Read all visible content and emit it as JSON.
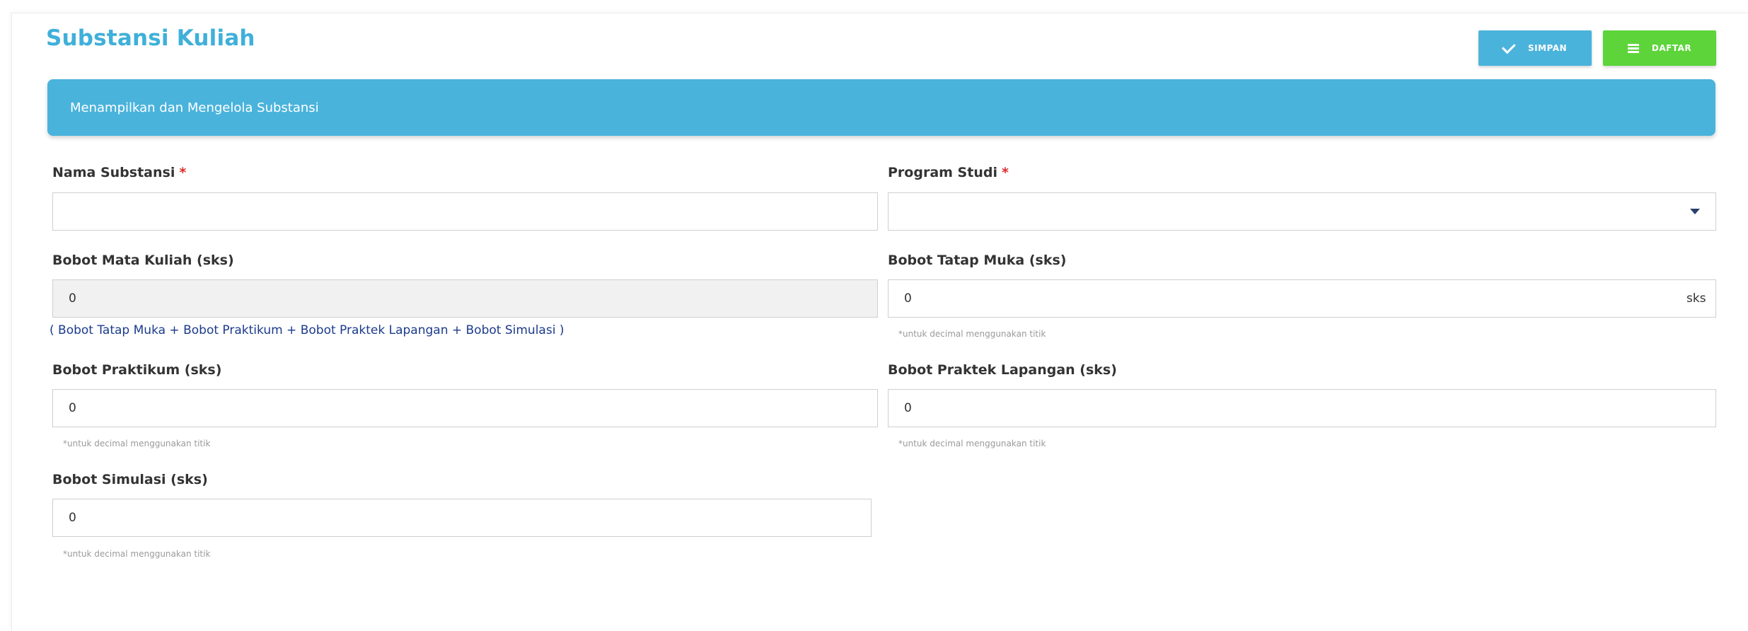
{
  "header": {
    "title": "Substansi Kuliah",
    "simpan_label": "SIMPAN",
    "daftar_label": "DAFTAR"
  },
  "banner": {
    "text": "Menampilkan dan Mengelola Substansi"
  },
  "form": {
    "nama_substansi": {
      "label": "Nama Substansi",
      "required": "*",
      "value": ""
    },
    "program_studi": {
      "label": "Program Studi",
      "required": "*",
      "selected": ""
    },
    "bobot_mata_kuliah": {
      "label": "Bobot Mata Kuliah (sks)",
      "value": "0",
      "formula": "( Bobot Tatap Muka + Bobot Praktikum + Bobot Praktek Lapangan + Bobot Simulasi )"
    },
    "bobot_tatap_muka": {
      "label": "Bobot Tatap Muka (sks)",
      "value": "0",
      "suffix": "sks",
      "hint": "*untuk decimal menggunakan titik"
    },
    "bobot_praktikum": {
      "label": "Bobot Praktikum (sks)",
      "value": "0",
      "hint": "*untuk decimal menggunakan titik"
    },
    "bobot_praktek_lapangan": {
      "label": "Bobot Praktek Lapangan (sks)",
      "value": "0",
      "hint": "*untuk decimal menggunakan titik"
    },
    "bobot_simulasi": {
      "label": "Bobot Simulasi (sks)",
      "value": "0",
      "hint": "*untuk decimal menggunakan titik"
    }
  },
  "colors": {
    "accent_blue": "#4ab3dc",
    "title_blue": "#3fb0d9",
    "success_green": "#5cd43a",
    "required_red": "#e02828",
    "formula_blue": "#1b3a8c"
  },
  "icons": {
    "simpan": "check-icon",
    "daftar": "list-icon",
    "select": "caret-down-icon"
  }
}
